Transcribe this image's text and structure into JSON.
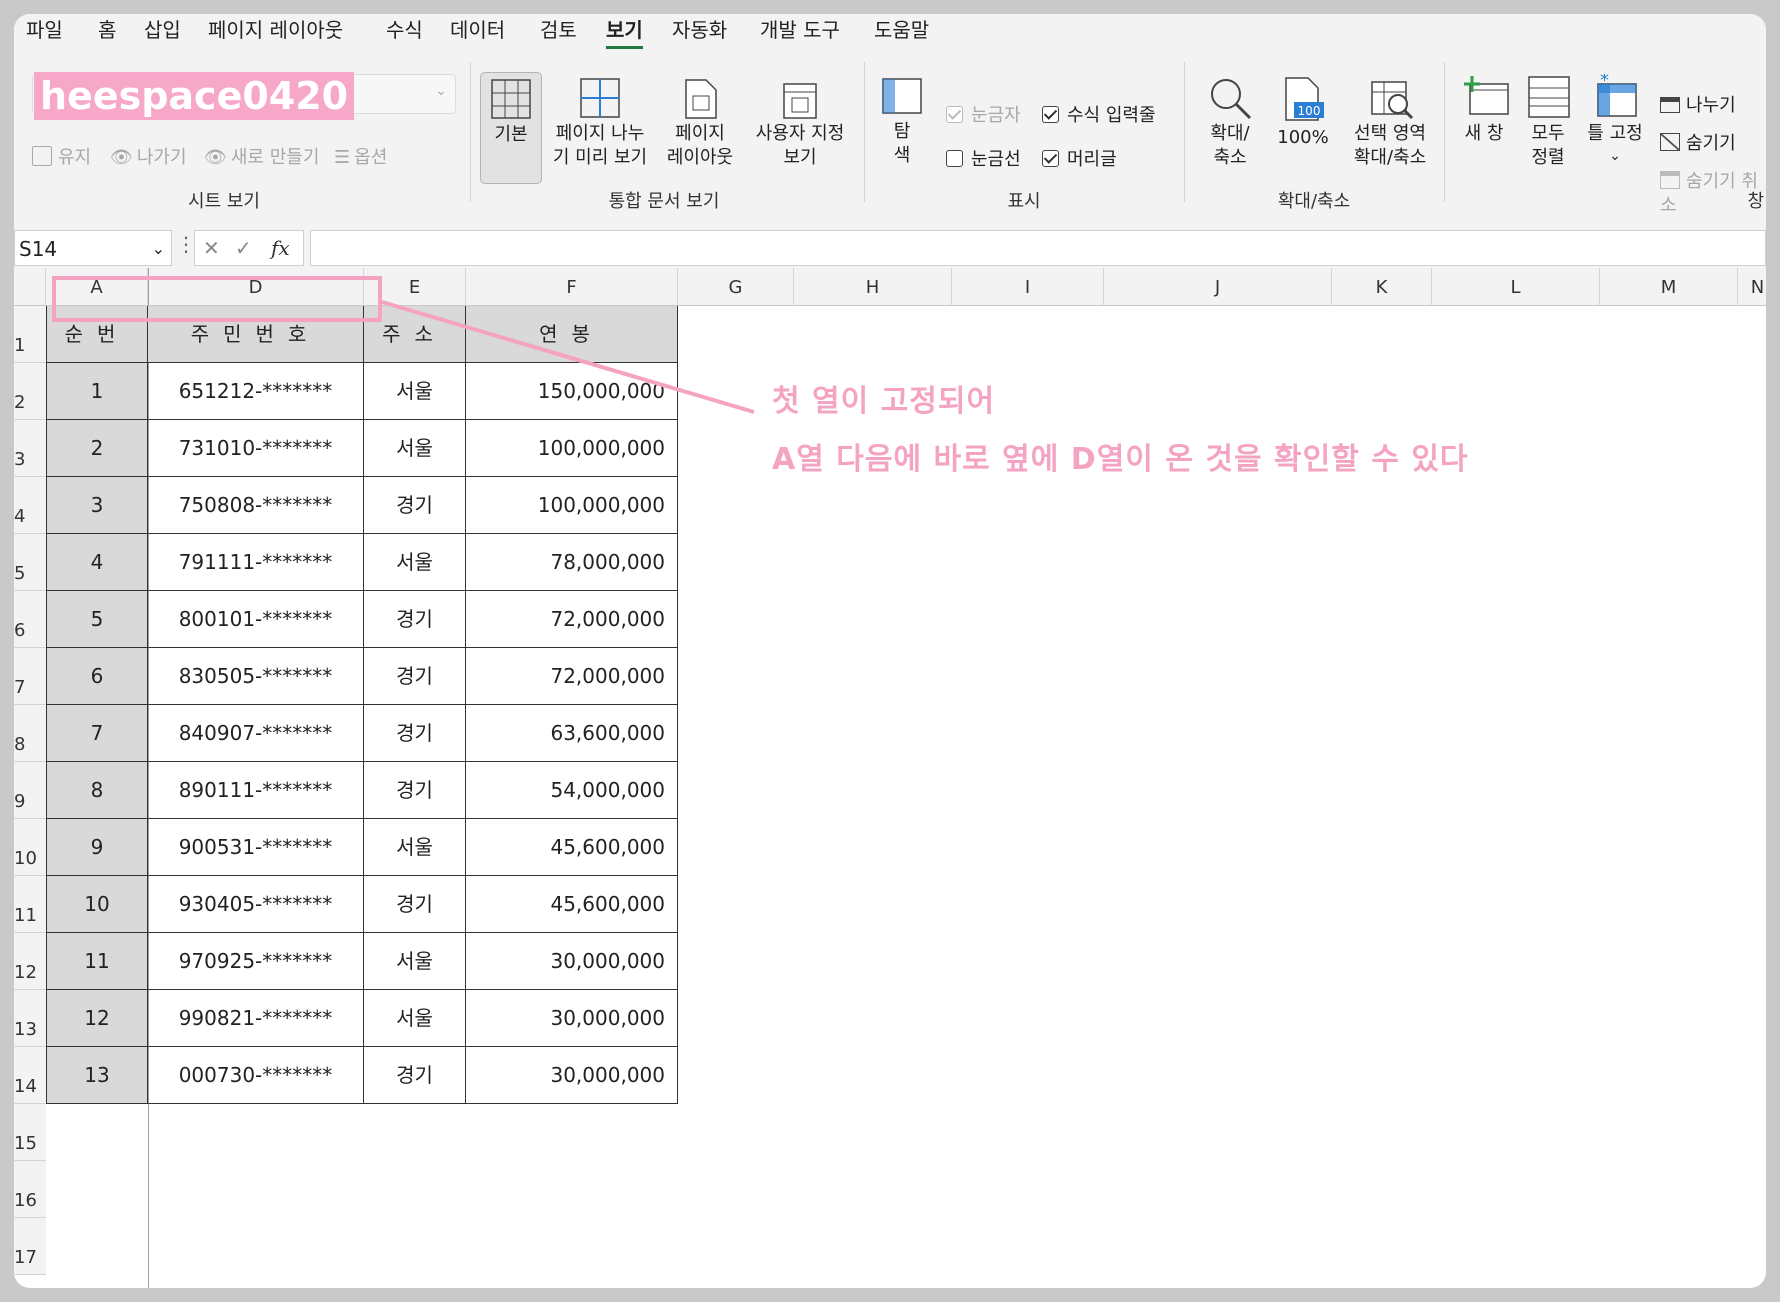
{
  "menu": {
    "tabs": [
      "파일",
      "홈",
      "삽입",
      "페이지 레이아웃",
      "수식",
      "데이터",
      "검토",
      "보기",
      "자동화",
      "개발 도구",
      "도움말"
    ],
    "active_tab": "보기"
  },
  "watermark": "heespace0420",
  "ribbon": {
    "sheet_view": {
      "keep": "유지",
      "exit": "나가기",
      "new": "새로 만들기",
      "options": "옵션",
      "label": "시트 보기"
    },
    "workbook_views": {
      "normal": "기본",
      "page_break": "페이지 나누\n기 미리 보기",
      "page_layout": "페이지\n레이아웃",
      "custom": "사용자 지정\n보기",
      "label": "통합 문서 보기"
    },
    "show": {
      "navigation": "탐\n색",
      "ruler": "눈금자",
      "formula_bar": "수식 입력줄",
      "gridlines": "눈금선",
      "headings": "머리글",
      "label": "표시"
    },
    "zoom": {
      "zoom": "확대/\n축소",
      "hundred": "100%",
      "to_selection": "선택 영역\n확대/축소",
      "label": "확대/축소",
      "icon_text": "100"
    },
    "window": {
      "new_window": "새 창",
      "arrange_all": "모두\n정렬",
      "freeze": "틀 고정",
      "freeze_caret": "⌄",
      "split": "나누기",
      "hide": "숨기기",
      "unhide": "숨기기 취소",
      "label": "창"
    }
  },
  "formula_bar": {
    "name_box": "S14",
    "formula": "",
    "fx": "fx"
  },
  "columns": [
    "A",
    "D",
    "E",
    "F",
    "G",
    "H",
    "I",
    "J",
    "K",
    "L",
    "M",
    "N"
  ],
  "rows": [
    "1",
    "2",
    "3",
    "4",
    "5",
    "6",
    "7",
    "8",
    "9",
    "10",
    "11",
    "12",
    "13",
    "14",
    "15",
    "16",
    "17"
  ],
  "table": {
    "headers": [
      "순번",
      "주민번호",
      "주소",
      "연봉"
    ],
    "rows": [
      [
        "1",
        "651212-*******",
        "서울",
        "150,000,000"
      ],
      [
        "2",
        "731010-*******",
        "서울",
        "100,000,000"
      ],
      [
        "3",
        "750808-*******",
        "경기",
        "100,000,000"
      ],
      [
        "4",
        "791111-*******",
        "서울",
        "78,000,000"
      ],
      [
        "5",
        "800101-*******",
        "경기",
        "72,000,000"
      ],
      [
        "6",
        "830505-*******",
        "경기",
        "72,000,000"
      ],
      [
        "7",
        "840907-*******",
        "경기",
        "63,600,000"
      ],
      [
        "8",
        "890111-*******",
        "경기",
        "54,000,000"
      ],
      [
        "9",
        "900531-*******",
        "서울",
        "45,600,000"
      ],
      [
        "10",
        "930405-*******",
        "경기",
        "45,600,000"
      ],
      [
        "11",
        "970925-*******",
        "서울",
        "30,000,000"
      ],
      [
        "12",
        "990821-*******",
        "서울",
        "30,000,000"
      ],
      [
        "13",
        "000730-*******",
        "경기",
        "30,000,000"
      ]
    ]
  },
  "annotation": {
    "line1": "첫 열이 고정되어",
    "line2": "A열 다음에 바로 옆에 D열이 온 것을 확인할 수 있다",
    "color": "#f5a3c2"
  }
}
